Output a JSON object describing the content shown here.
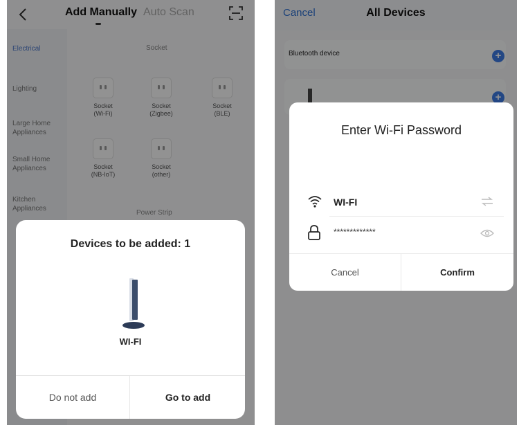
{
  "left_screen": {
    "header": {
      "tab_manual": "Add Manually",
      "tab_auto": "Auto Scan",
      "back_icon": "chevron-left-icon",
      "scan_icon": "scan-icon"
    },
    "sidebar": {
      "items": [
        {
          "label": "Electrical"
        },
        {
          "label": "Lighting"
        },
        {
          "label": "Large Home Appliances"
        },
        {
          "label": "Small Home Appliances"
        },
        {
          "label": "Kitchen Appliances"
        }
      ]
    },
    "content": {
      "section_socket": "Socket",
      "section_strip": "Power Strip",
      "sockets": [
        {
          "name": "Socket",
          "sub": "(Wi-Fi)"
        },
        {
          "name": "Socket",
          "sub": "(Zigbee)"
        },
        {
          "name": "Socket",
          "sub": "(BLE)"
        },
        {
          "name": "Socket",
          "sub": "(NB-IoT)"
        },
        {
          "name": "Socket",
          "sub": "(other)"
        }
      ]
    },
    "sheet": {
      "title": "Devices to be added: 1",
      "device_name": "WI-FI",
      "cancel_label": "Do not add",
      "confirm_label": "Go to add"
    }
  },
  "right_screen": {
    "header": {
      "cancel_label": "Cancel",
      "title": "All Devices"
    },
    "bluetooth_label": "Bluetooth device",
    "modal": {
      "title": "Enter Wi-Fi Password",
      "ssid": "WI-FI",
      "password_mask": "*************",
      "cancel_label": "Cancel",
      "confirm_label": "Confirm"
    }
  },
  "colors": {
    "accent": "#2c6fd1",
    "plus_button": "#3d7be3",
    "overlay": "#000000"
  }
}
